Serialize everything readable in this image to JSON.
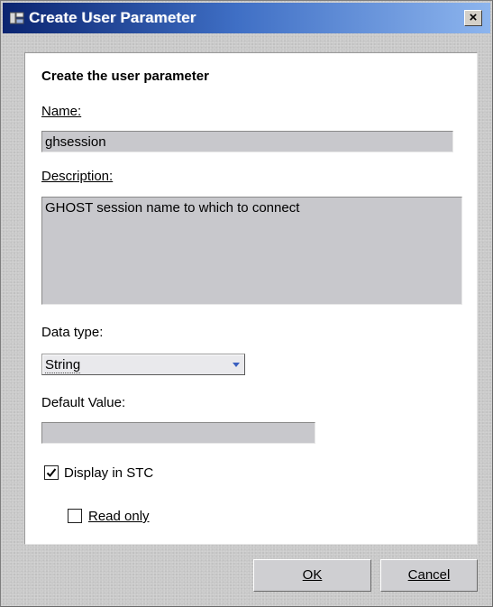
{
  "window": {
    "title": "Create User Parameter",
    "close_glyph": "×"
  },
  "form": {
    "heading": "Create the user parameter",
    "name_label": "Name:",
    "name_value": "ghsession",
    "description_label": "Description:",
    "description_value": "GHOST session name to which to connect",
    "data_type_label": "Data type:",
    "data_type_value": "String",
    "default_value_label": "Default Value:",
    "default_value": "",
    "display_in_stc": {
      "label": "Display in STC",
      "checked": true
    },
    "read_only": {
      "label": "Read only",
      "checked": false
    }
  },
  "buttons": {
    "ok": "OK",
    "cancel": "Cancel"
  },
  "icons": {
    "title_icon": "app-window-icon",
    "close": "close-icon",
    "dropdown_arrow": "chevron-down-icon",
    "check": "checkmark-icon"
  },
  "colors": {
    "titlebar_start": "#0a2470",
    "titlebar_end": "#8db5ee",
    "field_background": "#c8c8cc"
  }
}
